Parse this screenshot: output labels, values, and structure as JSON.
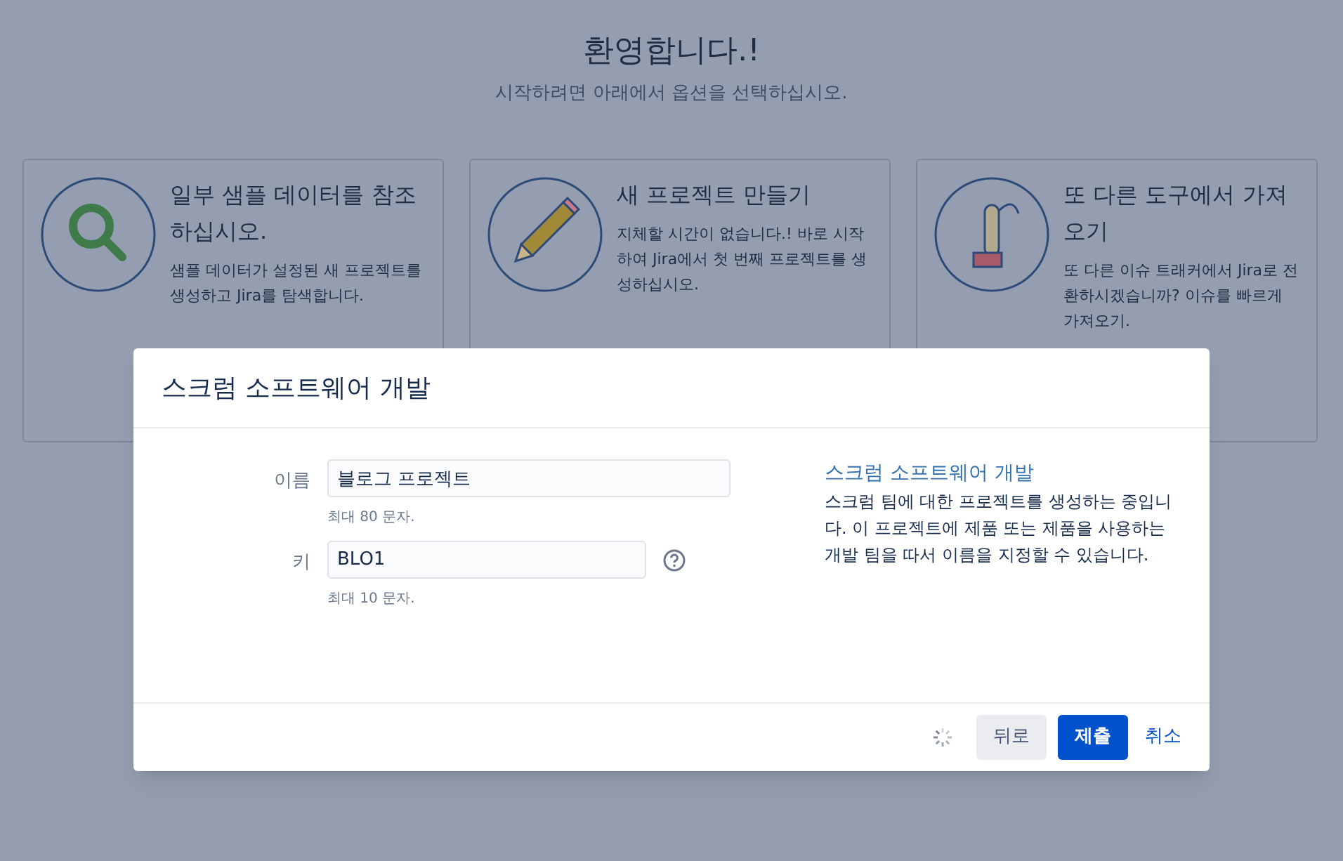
{
  "header": {
    "title": "환영합니다.!",
    "subtitle": "시작하려면 아래에서 옵션을 선택하십시오."
  },
  "cards": [
    {
      "title": "일부 샘플 데이터를 참조하십시오.",
      "description": "샘플 데이터가 설정된 새 프로젝트를 생성하고 Jira를 탐색합니다."
    },
    {
      "title": "새 프로젝트 만들기",
      "description": "지체할 시간이 없습니다.! 바로 시작하여 Jira에서 첫 번째 프로젝트를 생성하십시오."
    },
    {
      "title": "또 다른 도구에서 가져오기",
      "description": "또 다른 이슈 트래커에서 Jira로 전환하시겠습니까? 이슈를 빠르게 가져오기."
    }
  ],
  "dialog": {
    "title": "스크럼 소프트웨어 개발",
    "fields": [
      {
        "label": "이름",
        "value": "블로그 프로젝트",
        "hint": "최대 80 문자.",
        "help": false
      },
      {
        "label": "키",
        "value": "BLO1",
        "hint": "최대 10 문자.",
        "help": true
      }
    ],
    "info": {
      "title": "스크럼 소프트웨어 개발",
      "text": "스크럼 팀에 대한 프로젝트를 생성하는 중입니다. 이 프로젝트에 제품 또는 제품을 사용하는 개발 팀을 따서 이름을 지정할 수 있습니다."
    },
    "loading": true,
    "buttons": [
      {
        "label": "뒤로",
        "kind": "secondary"
      },
      {
        "label": "제출",
        "kind": "primary"
      },
      {
        "label": "취소",
        "kind": "link"
      }
    ]
  }
}
